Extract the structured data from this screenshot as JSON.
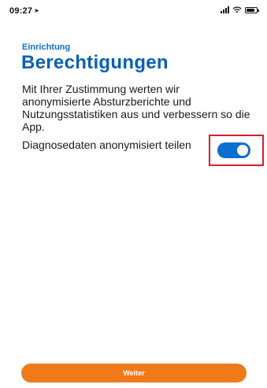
{
  "status_bar": {
    "time": "09:27",
    "location_icon": "location-arrow-icon",
    "signal_icon": "cellular-signal-icon",
    "wifi_icon": "wifi-icon",
    "battery_icon": "battery-icon"
  },
  "header": {
    "section_label": "Einrichtung",
    "title": "Berechtigungen"
  },
  "description": "Mit Ihrer Zustimmung werten wir anonymisierte Absturzberichte und Nutzungsstatistiken aus und verbessern so die App.",
  "setting": {
    "label": "Diagnosedaten anonymisiert teilen",
    "enabled": true,
    "toggle_color": "#0a6fd1"
  },
  "highlight_color": "#d6202a",
  "footer": {
    "continue_label": "Weiter",
    "continue_color": "#f07a1a"
  }
}
